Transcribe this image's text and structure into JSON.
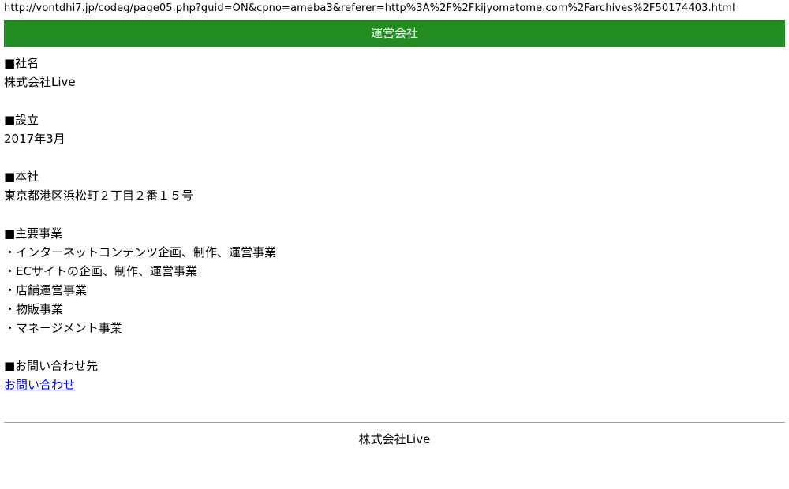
{
  "address_bar": {
    "url": "http://vontdhi7.jp/codeg/page05.php?guid=ON&cpno=ameba3&referer=http%3A%2F%2Fkijyomatome.com%2Farchives%2F50174403.html"
  },
  "header": {
    "title": "運営会社",
    "background_color": "#228b22"
  },
  "company": {
    "name_heading": "■社名",
    "name_value": "株式会社Live",
    "founded_heading": "■設立",
    "founded_value": "2017年3月",
    "hq_heading": "■本社",
    "hq_value": "東京都港区浜松町２丁目２番１５号",
    "business_heading": "■主要事業",
    "business_items": [
      "・インターネットコンテンツ企画、制作、運営事業",
      "・ECサイトの企画、制作、運営事業",
      "・店舗運営事業",
      "・物販事業",
      "・マネージメント事業"
    ],
    "contact_heading": "■お問い合わせ先",
    "contact_link": "お問い合わせ"
  },
  "footer": {
    "text": "株式会社Live",
    "rule_color": "#66cc66"
  }
}
